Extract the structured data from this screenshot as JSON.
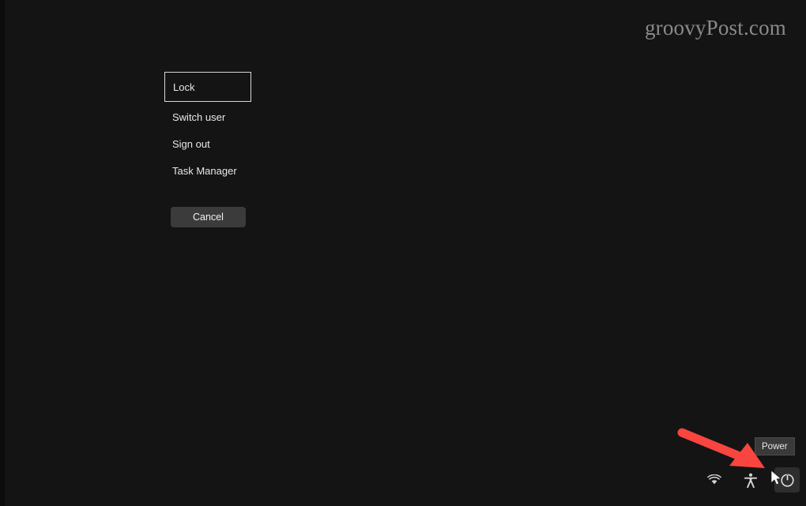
{
  "screen": {
    "background_color": "#141414",
    "watermark": "groovyPost.com"
  },
  "security_options_menu": {
    "items": [
      {
        "label": "Lock",
        "focused": true
      },
      {
        "label": "Switch user",
        "focused": false
      },
      {
        "label": "Sign out",
        "focused": false
      },
      {
        "label": "Task Manager",
        "focused": false
      }
    ],
    "cancel_label": "Cancel"
  },
  "tray": {
    "buttons": [
      {
        "icon": "wifi-icon",
        "hovered": false
      },
      {
        "icon": "accessibility-icon",
        "hovered": false
      },
      {
        "icon": "power-icon",
        "hovered": true
      }
    ],
    "tooltip": {
      "text": "Power",
      "background_color": "#3a3a3a"
    }
  },
  "annotation": {
    "arrow_color": "#f8453f",
    "points_to": "power-button"
  },
  "cursor": {
    "type": "arrow-pointer",
    "color": "#ffffff"
  }
}
